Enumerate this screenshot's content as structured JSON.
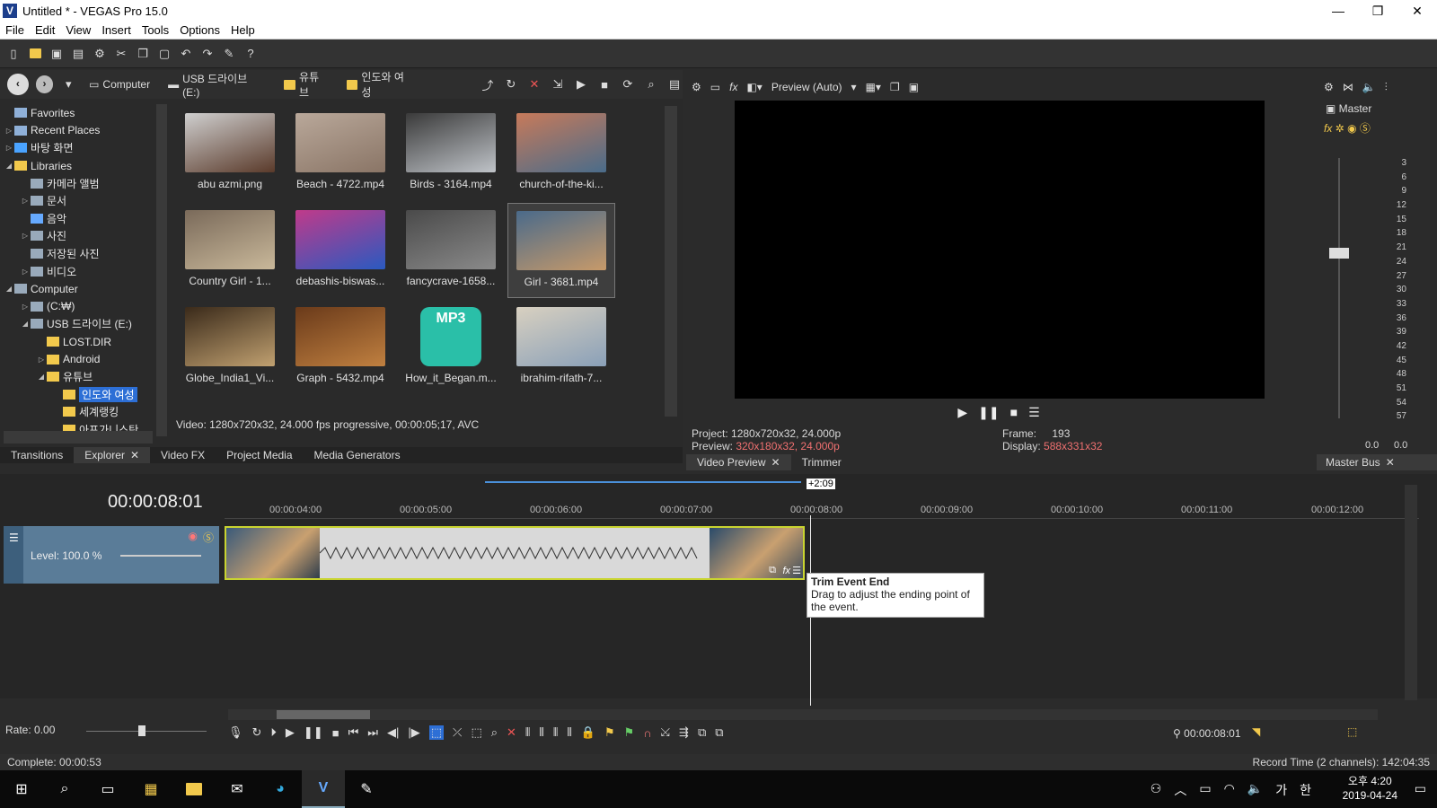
{
  "window": {
    "title": "Untitled * - VEGAS Pro 15.0",
    "min": "—",
    "max": "❐",
    "close": "✕"
  },
  "menu": [
    "File",
    "Edit",
    "View",
    "Insert",
    "Tools",
    "Options",
    "Help"
  ],
  "explorer": {
    "breadcrumbs": [
      "Computer",
      "USB 드라이브 (E:)",
      "유튜브",
      "인도와 여성"
    ],
    "tree": [
      {
        "label": "Favorites",
        "indent": 0,
        "arrow": "",
        "color": "#8fb0d8"
      },
      {
        "label": "Recent Places",
        "indent": 0,
        "arrow": "▷",
        "color": "#8fb0d8"
      },
      {
        "label": "바탕 화면",
        "indent": 0,
        "arrow": "▷",
        "color": "#4aa3ff"
      },
      {
        "label": "Libraries",
        "indent": 0,
        "arrow": "◢",
        "color": "#f2c94c"
      },
      {
        "label": "카메라 앨범",
        "indent": 1,
        "arrow": "",
        "color": "#9ab"
      },
      {
        "label": "문서",
        "indent": 1,
        "arrow": "▷",
        "color": "#9ab"
      },
      {
        "label": "음악",
        "indent": 1,
        "arrow": "",
        "color": "#6af"
      },
      {
        "label": "사진",
        "indent": 1,
        "arrow": "▷",
        "color": "#9ab"
      },
      {
        "label": "저장된 사진",
        "indent": 1,
        "arrow": "",
        "color": "#9ab"
      },
      {
        "label": "비디오",
        "indent": 1,
        "arrow": "▷",
        "color": "#9ab"
      },
      {
        "label": "Computer",
        "indent": 0,
        "arrow": "◢",
        "color": "#9ab"
      },
      {
        "label": "(C:₩)",
        "indent": 1,
        "arrow": "▷",
        "color": "#9ab"
      },
      {
        "label": "USB 드라이브 (E:)",
        "indent": 1,
        "arrow": "◢",
        "color": "#9ab"
      },
      {
        "label": "LOST.DIR",
        "indent": 2,
        "arrow": "",
        "color": "#f2c94c"
      },
      {
        "label": "Android",
        "indent": 2,
        "arrow": "▷",
        "color": "#f2c94c"
      },
      {
        "label": "유튜브",
        "indent": 2,
        "arrow": "◢",
        "color": "#f2c94c"
      },
      {
        "label": "인도와 여성",
        "indent": 3,
        "arrow": "",
        "color": "#f2c94c",
        "selected": true
      },
      {
        "label": "세계랭킹",
        "indent": 3,
        "arrow": "",
        "color": "#f2c94c"
      },
      {
        "label": "아프가니스탄",
        "indent": 3,
        "arrow": "",
        "color": "#f2c94c"
      }
    ],
    "media": [
      {
        "label": "abu azmi.png",
        "c1": "#cfcfcf",
        "c2": "#5a3a2a"
      },
      {
        "label": "Beach - 4722.mp4",
        "c1": "#b9a89a",
        "c2": "#8a7566"
      },
      {
        "label": "Birds - 3164.mp4",
        "c1": "#3a3a3a",
        "c2": "#bfc3c8"
      },
      {
        "label": "church-of-the-ki...",
        "c1": "#c77a5a",
        "c2": "#4a6c8a"
      },
      {
        "label": "Country Girl - 1...",
        "c1": "#7a6a5a",
        "c2": "#c9b89a"
      },
      {
        "label": "debashis-biswas...",
        "c1": "#c03a8a",
        "c2": "#2a5ac0"
      },
      {
        "label": "fancycrave-1658...",
        "c1": "#4a4a4a",
        "c2": "#8a8a8a"
      },
      {
        "label": "Girl - 3681.mp4",
        "c1": "#4a6a8a",
        "c2": "#c79a6a",
        "selected": true
      },
      {
        "label": "Globe_India1_Vi...",
        "c1": "#3a2a1a",
        "c2": "#c0a070"
      },
      {
        "label": "Graph - 5432.mp4",
        "c1": "#6a3a1a",
        "c2": "#c08040"
      },
      {
        "label": "How_it_Began.m...",
        "c1": "#2abfa8",
        "c2": "#2abfa8",
        "mp3": "MP3"
      },
      {
        "label": "ibrahim-rifath-7...",
        "c1": "#d8d0c0",
        "c2": "#8aa0b8"
      }
    ],
    "status": "Video: 1280x720x32, 24.000 fps progressive, 00:00:05;17, AVC"
  },
  "tabs": [
    {
      "label": "Transitions",
      "close": ""
    },
    {
      "label": "Explorer",
      "close": "✕",
      "active": true
    },
    {
      "label": "Video FX",
      "close": ""
    },
    {
      "label": "Project Media",
      "close": ""
    },
    {
      "label": "Media Generators",
      "close": ""
    }
  ],
  "preview": {
    "mode": "Preview (Auto)",
    "project_label": "Project:",
    "project": "1280x720x32, 24.000p",
    "preview_label": "Preview:",
    "preview": "320x180x32, 24.000p",
    "frame_label": "Frame:",
    "frame": "193",
    "display_label": "Display:",
    "display": "588x331x32",
    "tab_video": "Video Preview",
    "tab_trimmer": "Trimmer"
  },
  "master": {
    "label": "Master",
    "ticks": [
      "3",
      "6",
      "9",
      "12",
      "15",
      "18",
      "21",
      "24",
      "27",
      "30",
      "33",
      "36",
      "39",
      "42",
      "45",
      "48",
      "51",
      "54",
      "57"
    ],
    "left_val": "0.0",
    "right_val": "0.0",
    "tab": "Master Bus"
  },
  "timeline": {
    "timecode": "00:00:08:01",
    "offset": "+2:09",
    "ruler": [
      "00:00:04:00",
      "00:00:05:00",
      "00:00:06:00",
      "00:00:07:00",
      "00:00:08:00",
      "00:00:09:00",
      "00:00:10:00",
      "00:00:11:00",
      "00:00:12:00"
    ],
    "level": "Level: 100.0 %",
    "tooltip_title": "Trim Event End",
    "tooltip_body": "Drag to adjust the ending point of the event.",
    "rate": "Rate: 0.00",
    "cursor_time": "00:00:08:01"
  },
  "status": {
    "complete": "Complete: 00:00:53",
    "record": "Record Time (2 channels): 142:04:35"
  },
  "taskbar": {
    "clock_time": "오후 4:20",
    "clock_date": "2019-04-24",
    "ime": "가",
    "lang": "한"
  }
}
